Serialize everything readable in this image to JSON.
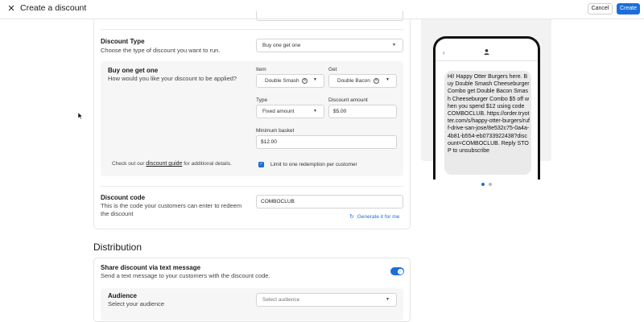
{
  "header": {
    "title": "Create a discount",
    "cancel_label": "Cancel",
    "create_label": "Create"
  },
  "discount_type": {
    "title": "Discount Type",
    "description": "Choose the type of discount you want to run.",
    "selected": "Buy one get one"
  },
  "bogo": {
    "title": "Buy one get one",
    "description": "How would you like your discount to be applied?",
    "item_label": "Item",
    "item_value": "Double Smash",
    "get_label": "Get",
    "get_value": "Double Bacon",
    "type_label": "Type",
    "type_value": "Fixed amount",
    "amount_label": "Discount amount",
    "amount_value": "$5.00",
    "min_basket_label": "Minimum basket",
    "min_basket_value": "$12.00",
    "guide_prefix": "Check out our",
    "guide_link": "discount guide",
    "guide_suffix": "for additional details.",
    "limit_label": "Limit to one redemption per customer",
    "limit_checked": true
  },
  "discount_code": {
    "title": "Discount code",
    "description": "This is the code your customers can enter to redeem the discount",
    "value": "COMBOCLUB",
    "generate_label": "Generate it for me"
  },
  "distribution": {
    "title": "Distribution",
    "share_title": "Share discount via text message",
    "share_description": "Send a text message to your customers with the discount code.",
    "share_enabled": true,
    "audience_title": "Audience",
    "audience_description": "Select your audience",
    "audience_placeholder": "Select audience"
  },
  "preview": {
    "message": "Hi! Happy Otter Burgers here. Buy Double Smash Cheeseburger Combo get Double Bacon Smash Cheeseburger Combo $5 off when you spend $12 using code COMBOCLUB. https://order.tryotter.com/s/happy-otter-burgers/ruff-drive-san-jose/8e532c75-0a4a-4b81-b554-eb0733922438?discount=COMBOCLUB. Reply STOP to unsubscribe",
    "page_count": 2,
    "active_page": 1
  },
  "colors": {
    "accent": "#1a6fd9",
    "panel": "#f6f6f6",
    "border": "#e5e5e5"
  },
  "icons": {
    "close": "close-icon",
    "caret": "chevron-down-icon",
    "clear": "clear-icon",
    "refresh": "refresh-icon",
    "back": "chevron-left-icon",
    "contact": "person-icon",
    "check": "check-icon"
  }
}
